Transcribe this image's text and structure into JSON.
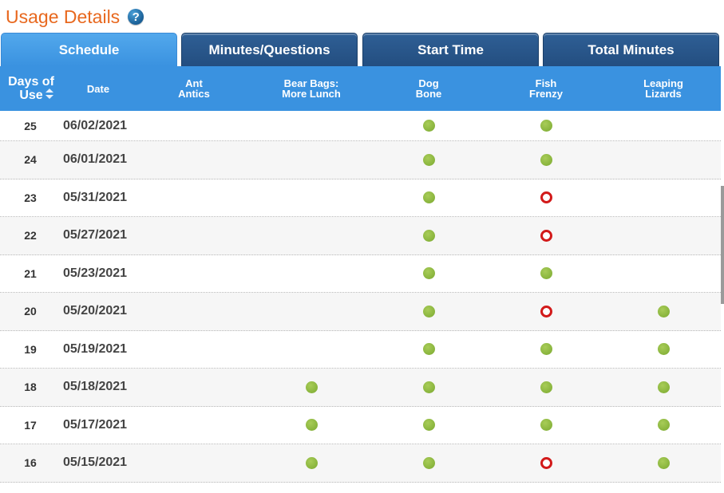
{
  "page_title": "Usage Details",
  "help_icon": "question-circle-icon",
  "tabs": [
    {
      "label": "Schedule",
      "active": true
    },
    {
      "label": "Minutes/Questions",
      "active": false
    },
    {
      "label": "Start Time",
      "active": false
    },
    {
      "label": "Total Minutes",
      "active": false
    }
  ],
  "columns": {
    "days_of_use": "Days of Use",
    "date": "Date",
    "activities": [
      "Ant Antics",
      "Bear Bags: More Lunch",
      "Dog Bone",
      "Fish Frenzy",
      "Leaping Lizards"
    ]
  },
  "status_legend": {
    "done": "green-dot-icon",
    "missed": "red-ring-icon"
  },
  "colors": {
    "title": "#e8681e",
    "header": "#3a92e0",
    "tab_inactive": "#2f5f95",
    "done": "#8cb840",
    "missed": "#d21a1a"
  },
  "rows": [
    {
      "day": "25",
      "date": "06/02/2021",
      "status": [
        "",
        "",
        "done",
        "done",
        ""
      ]
    },
    {
      "day": "24",
      "date": "06/01/2021",
      "status": [
        "",
        "",
        "done",
        "done",
        ""
      ]
    },
    {
      "day": "23",
      "date": "05/31/2021",
      "status": [
        "",
        "",
        "done",
        "missed",
        ""
      ]
    },
    {
      "day": "22",
      "date": "05/27/2021",
      "status": [
        "",
        "",
        "done",
        "missed",
        ""
      ]
    },
    {
      "day": "21",
      "date": "05/23/2021",
      "status": [
        "",
        "",
        "done",
        "done",
        ""
      ]
    },
    {
      "day": "20",
      "date": "05/20/2021",
      "status": [
        "",
        "",
        "done",
        "missed",
        "done"
      ]
    },
    {
      "day": "19",
      "date": "05/19/2021",
      "status": [
        "",
        "",
        "done",
        "done",
        "done"
      ]
    },
    {
      "day": "18",
      "date": "05/18/2021",
      "status": [
        "",
        "done",
        "done",
        "done",
        "done"
      ]
    },
    {
      "day": "17",
      "date": "05/17/2021",
      "status": [
        "",
        "done",
        "done",
        "done",
        "done"
      ]
    },
    {
      "day": "16",
      "date": "05/15/2021",
      "status": [
        "",
        "done",
        "done",
        "missed",
        "done"
      ]
    }
  ]
}
